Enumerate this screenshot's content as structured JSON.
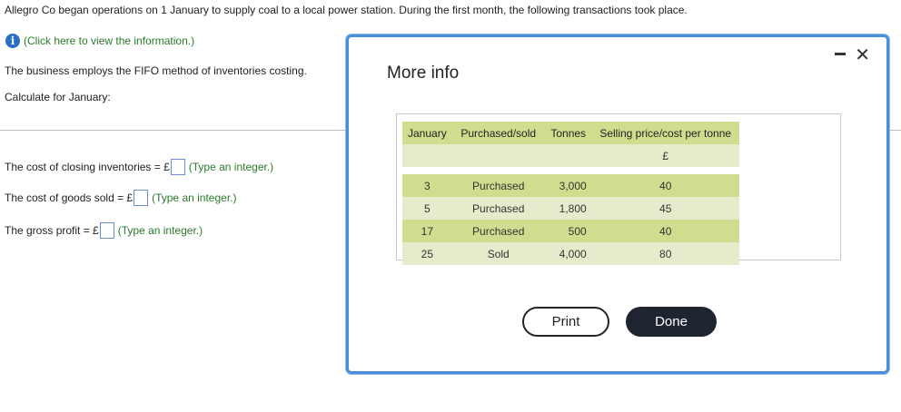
{
  "question": {
    "intro": "Allegro Co began operations on 1 January to supply coal to a local power station. During the first month, the following transactions took place.",
    "info_link": "(Click here to view the information.)",
    "info_icon": "info-icon",
    "line1": "The business employs the FIFO method of inventories costing.",
    "line2": "Calculate for January:"
  },
  "answers": [
    {
      "label": "The cost of closing inventories = £",
      "hint": "(Type an integer.)"
    },
    {
      "label": "The cost of goods sold = £",
      "hint": "(Type an integer.)"
    },
    {
      "label": "The gross profit = £",
      "hint": "(Type an integer.)"
    }
  ],
  "modal": {
    "title": "More info",
    "minimize_icon": "minimize-icon",
    "close_icon": "close-icon",
    "close_glyph": "✕",
    "table": {
      "headers": [
        "January",
        "Purchased/sold",
        "Tonnes",
        "Selling price/cost per tonne"
      ],
      "subheader": [
        "",
        "",
        "",
        "£"
      ],
      "rows": [
        [
          "3",
          "Purchased",
          "3,000",
          "40"
        ],
        [
          "5",
          "Purchased",
          "1,800",
          "45"
        ],
        [
          "17",
          "Purchased",
          "500",
          "40"
        ],
        [
          "25",
          "Sold",
          "4,000",
          "80"
        ]
      ]
    },
    "buttons": {
      "print": "Print",
      "done": "Done"
    }
  },
  "colors": {
    "accent_blue": "#4a90d9",
    "hint_green": "#2a7a2a",
    "table_header": "#d2dc8e",
    "table_row_light": "#e6eccb",
    "done_button": "#1e2530"
  }
}
